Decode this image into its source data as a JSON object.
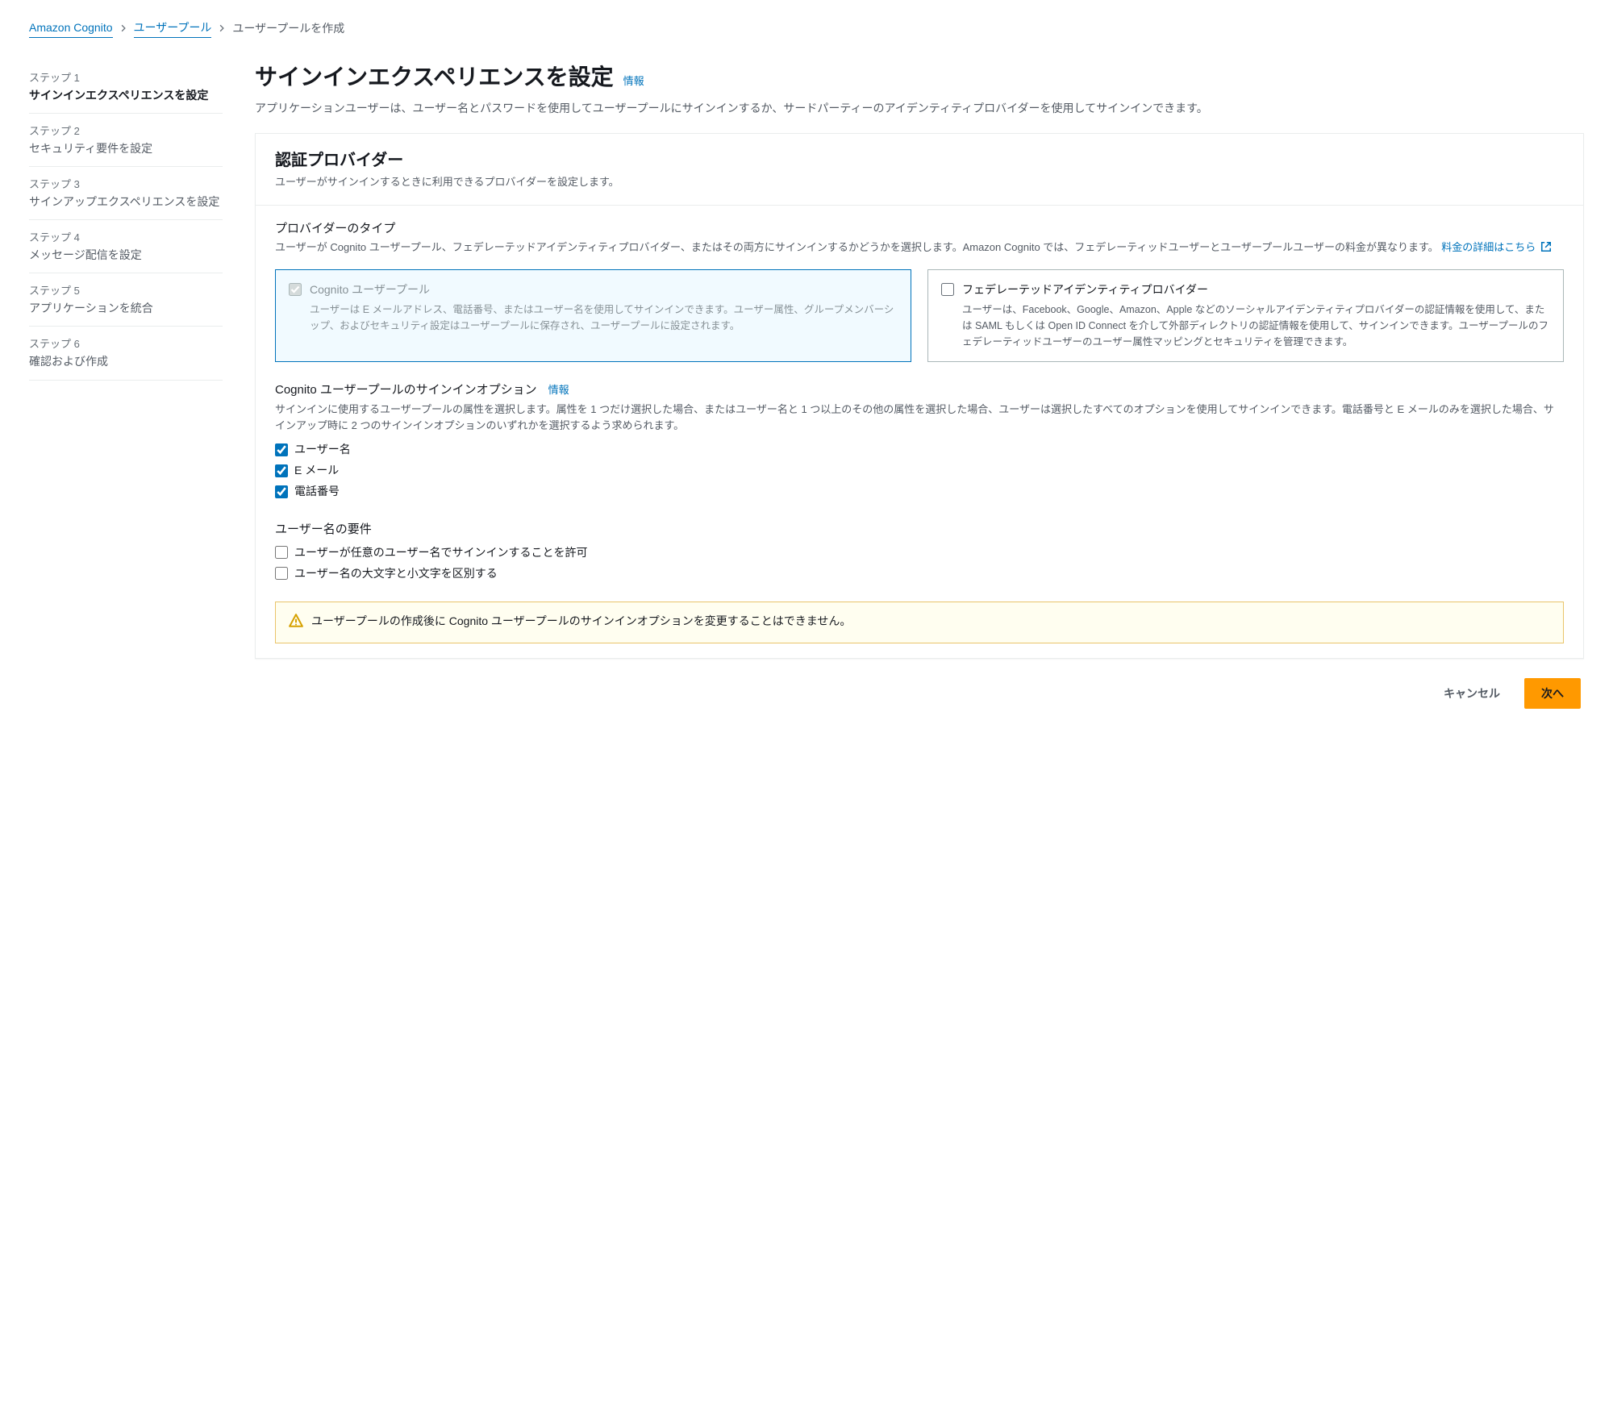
{
  "breadcrumb": {
    "root": "Amazon Cognito",
    "pool": "ユーザープール",
    "current": "ユーザープールを作成"
  },
  "steps": [
    {
      "num": "ステップ 1",
      "title": "サインインエクスペリエンスを設定"
    },
    {
      "num": "ステップ 2",
      "title": "セキュリティ要件を設定"
    },
    {
      "num": "ステップ 3",
      "title": "サインアップエクスペリエンスを設定"
    },
    {
      "num": "ステップ 4",
      "title": "メッセージ配信を設定"
    },
    {
      "num": "ステップ 5",
      "title": "アプリケーションを統合"
    },
    {
      "num": "ステップ 6",
      "title": "確認および作成"
    }
  ],
  "page": {
    "title": "サインインエクスペリエンスを設定",
    "info_label": "情報",
    "desc": "アプリケーションユーザーは、ユーザー名とパスワードを使用してユーザープールにサインインするか、サードパーティーのアイデンティティプロバイダーを使用してサインインできます。"
  },
  "panel": {
    "title": "認証プロバイダー",
    "subtitle": "ユーザーがサインインするときに利用できるプロバイダーを設定します。"
  },
  "provider_type": {
    "heading": "プロバイダーのタイプ",
    "desc": "ユーザーが Cognito ユーザープール、フェデレーテッドアイデンティティプロバイダー、またはその両方にサインインするかどうかを選択します。Amazon Cognito では、フェデレーティッドユーザーとユーザープールユーザーの料金が異なります。",
    "pricing_link": "料金の詳細はこちら",
    "cognito": {
      "title": "Cognito ユーザープール",
      "desc": "ユーザーは E メールアドレス、電話番号、またはユーザー名を使用してサインインできます。ユーザー属性、グループメンバーシップ、およびセキュリティ設定はユーザープールに保存され、ユーザープールに設定されます。"
    },
    "federated": {
      "title": "フェデレーテッドアイデンティティプロバイダー",
      "desc": "ユーザーは、Facebook、Google、Amazon、Apple などのソーシャルアイデンティティプロバイダーの認証情報を使用して、または SAML もしくは Open ID Connect を介して外部ディレクトリの認証情報を使用して、サインインできます。ユーザープールのフェデレーティッドユーザーのユーザー属性マッピングとセキュリティを管理できます。"
    }
  },
  "signin_options": {
    "heading": "Cognito ユーザープールのサインインオプション",
    "info_label": "情報",
    "desc": "サインインに使用するユーザープールの属性を選択します。属性を 1 つだけ選択した場合、またはユーザー名と 1 つ以上のその他の属性を選択した場合、ユーザーは選択したすべてのオプションを使用してサインインできます。電話番号と E メールのみを選択した場合、サインアップ時に 2 つのサインインオプションのいずれかを選択するよう求められます。",
    "opts": {
      "username": "ユーザー名",
      "email": "E メール",
      "phone": "電話番号"
    }
  },
  "username_req": {
    "heading": "ユーザー名の要件",
    "opts": {
      "arbitrary": "ユーザーが任意のユーザー名でサインインすることを許可",
      "case_sensitive": "ユーザー名の大文字と小文字を区別する"
    }
  },
  "alert": {
    "text": "ユーザープールの作成後に Cognito ユーザープールのサインインオプションを変更することはできません。"
  },
  "footer": {
    "cancel": "キャンセル",
    "next": "次へ"
  }
}
